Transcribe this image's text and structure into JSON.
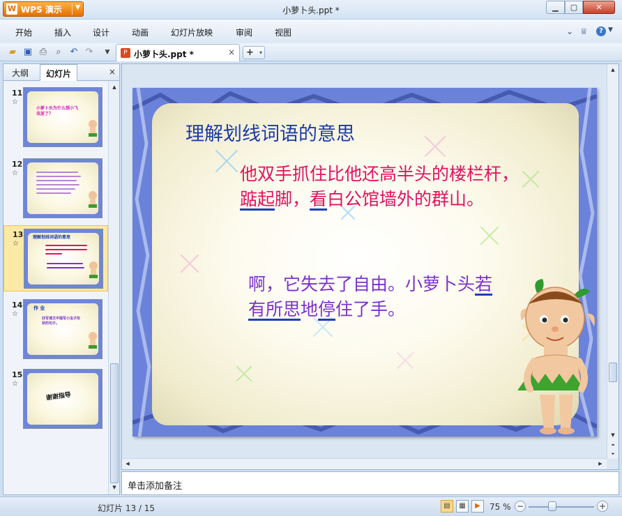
{
  "window": {
    "title": "小萝卜头.ppt *",
    "app_label": "WPS 演示",
    "min_icon": "minimize-icon",
    "max_icon": "maximize-icon",
    "close_icon": "close-icon"
  },
  "menu": {
    "items": [
      "开始",
      "插入",
      "设计",
      "动画",
      "幻灯片放映",
      "审阅",
      "视图"
    ],
    "right_icons": [
      "chevron-down-icon",
      "skin-icon",
      "help-icon"
    ]
  },
  "toolbar": {
    "icons": [
      "open-folder-icon",
      "save-icon",
      "print-icon",
      "print-preview-icon",
      "undo-icon",
      "redo-icon",
      "customize-dropdown-icon"
    ],
    "doc_tab": {
      "label": "小萝卜头.ppt *",
      "close": "×"
    },
    "new_tab": {
      "label": "+"
    }
  },
  "left_panel": {
    "tabs": [
      "大纲",
      "幻灯片"
    ],
    "active_tab": "幻灯片",
    "close": "×",
    "thumbnails": [
      {
        "num": "11",
        "star": "☆",
        "text": "小萝卜头为什么想小飞虫放了？"
      },
      {
        "num": "12",
        "star": "☆",
        "text": ""
      },
      {
        "num": "13",
        "star": "☆",
        "text": "理解划线词语的意思",
        "selected": true
      },
      {
        "num": "14",
        "star": "☆",
        "text": "作 业",
        "subtext": "抄写课文中描写小虫子形状的句子。"
      },
      {
        "num": "15",
        "star": "☆",
        "text": "谢谢指导"
      }
    ]
  },
  "slide": {
    "title": "理解划线词语的意思",
    "para1": {
      "before": "他双手抓住比他还高半头的楼栏杆，",
      "u1": "踮起",
      "mid1": "脚，",
      "u2": "看",
      "after": "白公馆墙外的群山。"
    },
    "para2": {
      "before": "啊，它失去了自由。小萝卜头",
      "u1": "若有所思",
      "mid1": "地",
      "u2": "停",
      "after": "住了手。"
    }
  },
  "notes": {
    "placeholder": "单击添加备注"
  },
  "status": {
    "slide_info": "幻灯片 13 / 15",
    "zoom": "75 %",
    "zoom_minus": "−",
    "zoom_plus": "+"
  },
  "colors": {
    "slide_title": "#1b3aa8",
    "para1": "#e0135f",
    "para2": "#7b32cc",
    "underline": "#1c3fb8"
  }
}
